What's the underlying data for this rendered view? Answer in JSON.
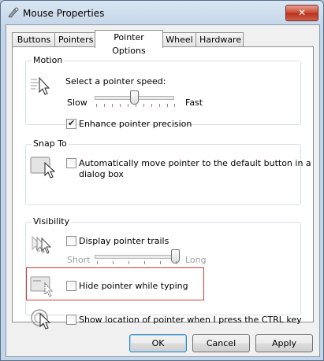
{
  "window": {
    "title": "Mouse Properties",
    "close_glyph": "✕"
  },
  "tabs": [
    {
      "label": "Buttons"
    },
    {
      "label": "Pointers"
    },
    {
      "label": "Pointer Options"
    },
    {
      "label": "Wheel"
    },
    {
      "label": "Hardware"
    }
  ],
  "motion": {
    "group_label": "Motion",
    "speed_label": "Select a pointer speed:",
    "slow_label": "Slow",
    "fast_label": "Fast",
    "speed_level_fraction": 0.5,
    "enhance_label": "Enhance pointer precision",
    "enhance_checked": true
  },
  "snap_to": {
    "group_label": "Snap To",
    "checkbox_label_line1": "Automatically move pointer to the default button in a",
    "checkbox_label_line2": "dialog box",
    "checked": false
  },
  "visibility": {
    "group_label": "Visibility",
    "trails_label": "Display pointer trails",
    "trails_checked": false,
    "short_label": "Short",
    "long_label": "Long",
    "trail_length_fraction": 1.0,
    "hide_label": "Hide pointer while typing",
    "hide_checked": false,
    "ctrl_label": "Show location of pointer when I press the CTRL key",
    "ctrl_checked": false
  },
  "buttons": {
    "ok": "OK",
    "cancel": "Cancel",
    "apply": "Apply"
  },
  "colors": {
    "highlight_border": "#d03a3a",
    "default_button_border": "#3c7fb1",
    "close_button": "#c9482f"
  }
}
